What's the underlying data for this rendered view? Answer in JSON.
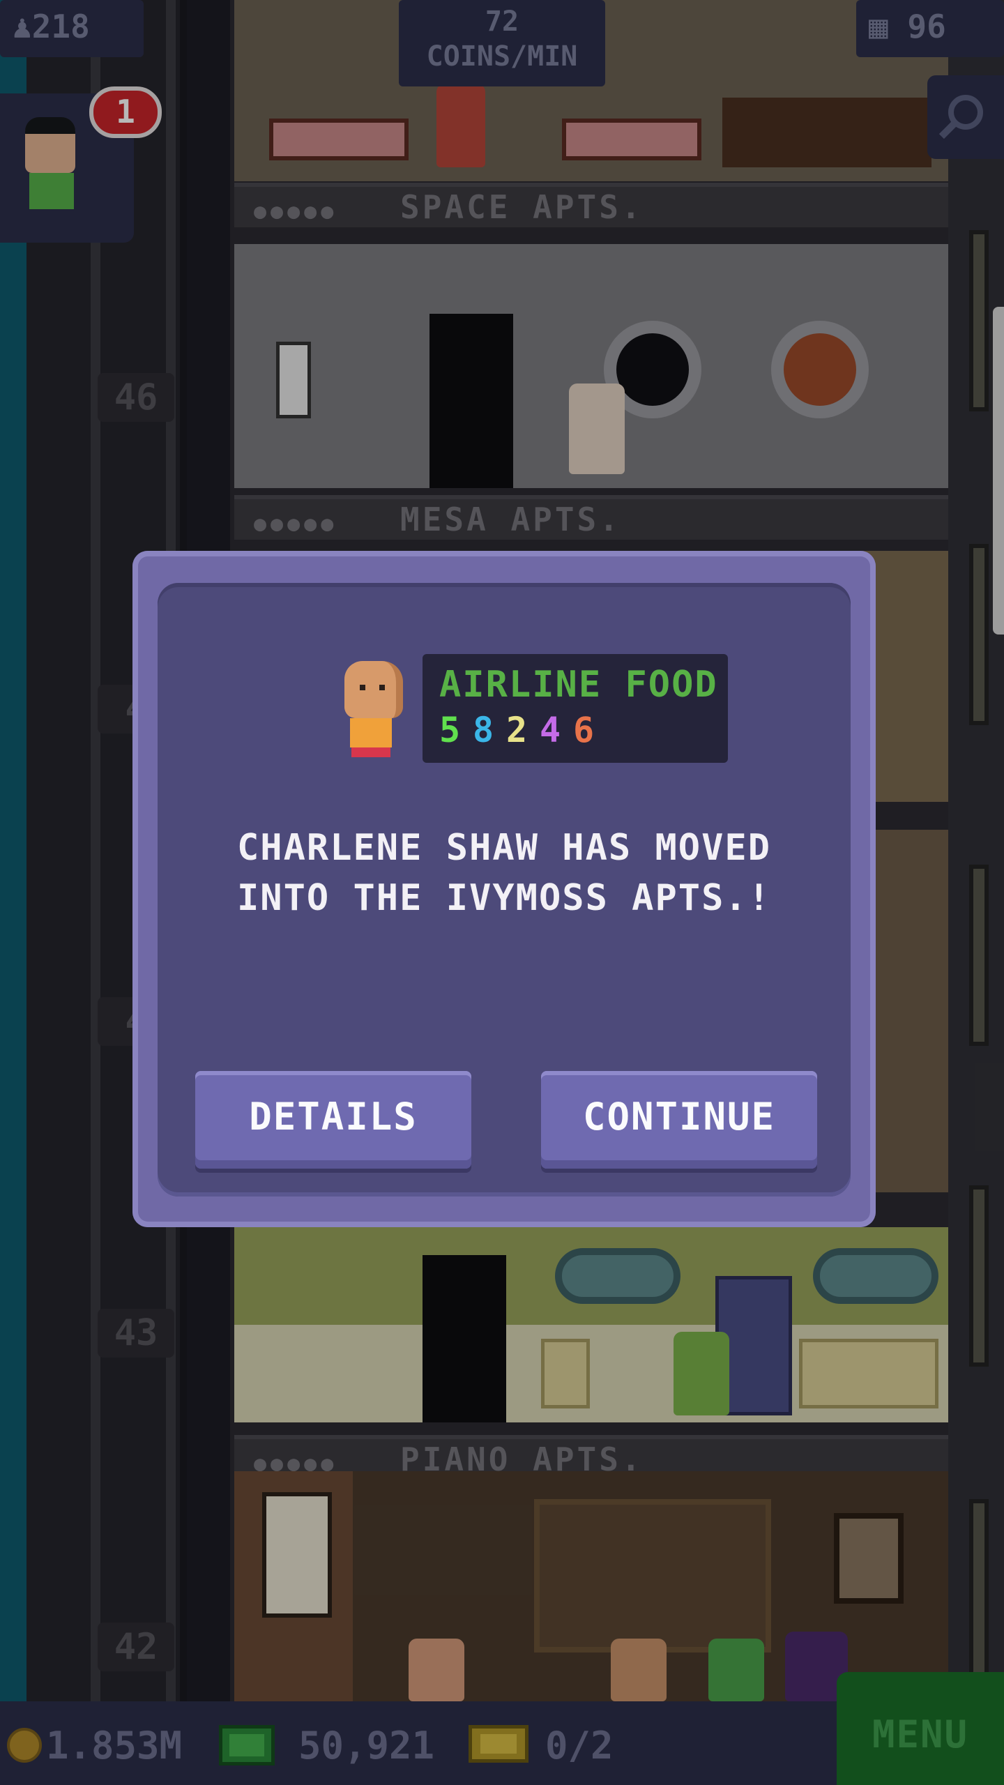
{
  "hud": {
    "population": "218",
    "coins_per_min_value": "72",
    "coins_per_min_label": "COINS/MIN",
    "floors": "96",
    "notification_count": "1"
  },
  "tower": {
    "floor_labels": [
      "SPACE APTS.",
      "MESA APTS.",
      "PIANO APTS."
    ],
    "floor_numbers": [
      "46",
      "4",
      "4",
      "43",
      "42"
    ]
  },
  "dialog": {
    "dream_job": "AIRLINE FOOD",
    "skills": [
      "5",
      "8",
      "2",
      "4",
      "6"
    ],
    "skill_colors": [
      "#61e04e",
      "#3bb6e8",
      "#e8e28a",
      "#c56ce8",
      "#e8734a"
    ],
    "message_line1": "CHARLENE SHAW HAS MOVED",
    "message_line2": "INTO THE IVYMOSS APTS.!",
    "details_label": "DETAILS",
    "continue_label": "CONTINUE"
  },
  "bottom": {
    "coins": "1.853M",
    "bux": "50,921",
    "tickets": "0/2",
    "menu_label": "MENU"
  },
  "icons": [
    "population-icon",
    "floors-icon",
    "search-icon",
    "coin-icon",
    "bux-icon",
    "ticket-icon"
  ]
}
